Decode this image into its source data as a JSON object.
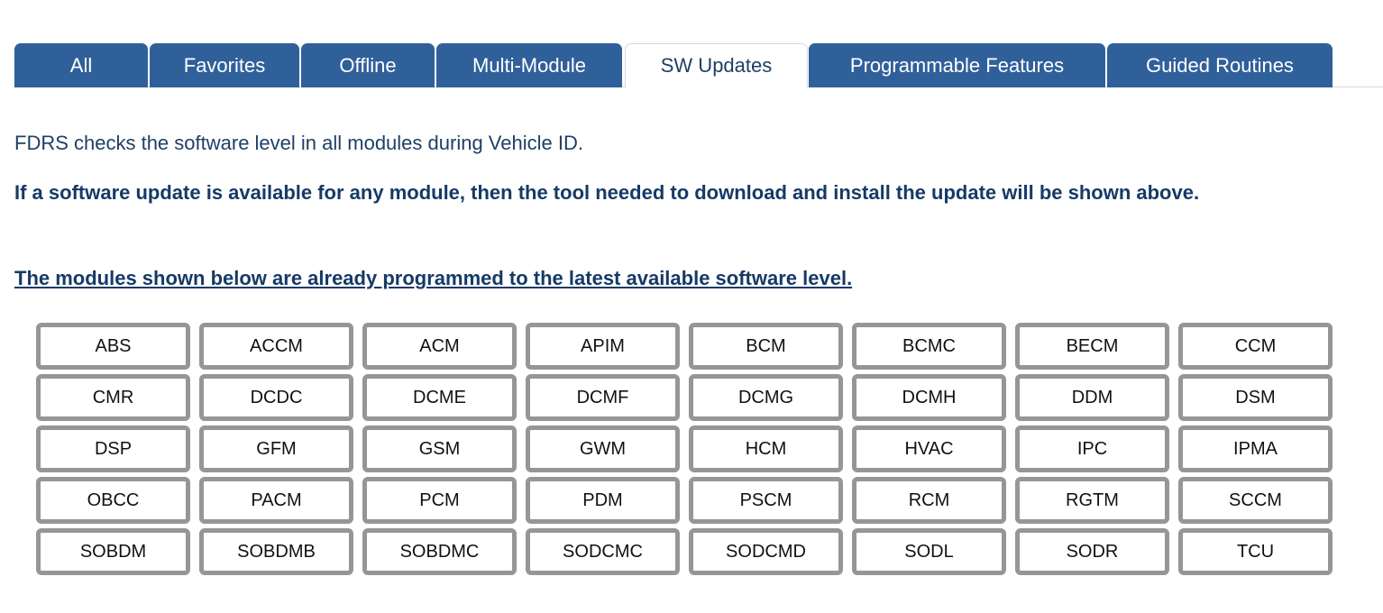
{
  "tabs": [
    {
      "label": "All"
    },
    {
      "label": "Favorites"
    },
    {
      "label": "Offline"
    },
    {
      "label": "Multi-Module"
    },
    {
      "label": "SW Updates"
    },
    {
      "label": "Programmable Features"
    },
    {
      "label": "Guided Routines"
    }
  ],
  "active_tab": "SW Updates",
  "content": {
    "intro": "FDRS checks the software level in all modules during Vehicle ID.",
    "notice": "If a software update is available for any module, then the tool needed to download and install the update will be shown above.",
    "latest_heading": "The modules shown below are already programmed to the latest available software level."
  },
  "modules": [
    "ABS",
    "ACCM",
    "ACM",
    "APIM",
    "BCM",
    "BCMC",
    "BECM",
    "CCM",
    "CMR",
    "DCDC",
    "DCME",
    "DCMF",
    "DCMG",
    "DCMH",
    "DDM",
    "DSM",
    "DSP",
    "GFM",
    "GSM",
    "GWM",
    "HCM",
    "HVAC",
    "IPC",
    "IPMA",
    "OBCC",
    "PACM",
    "PCM",
    "PDM",
    "PSCM",
    "RCM",
    "RGTM",
    "SCCM",
    "SOBDM",
    "SOBDMB",
    "SOBDMC",
    "SODCMC",
    "SODCMD",
    "SODL",
    "SODR",
    "TCU"
  ],
  "colors": {
    "tab_bg": "#30609a",
    "tab_text": "#ffffff",
    "text": "#1f3f66",
    "module_border": "#969696"
  }
}
